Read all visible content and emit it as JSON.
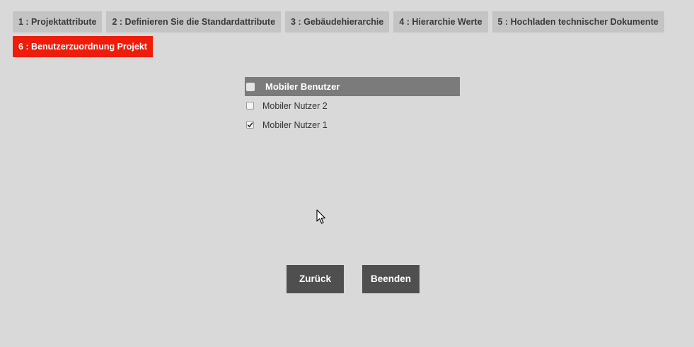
{
  "tabs": [
    {
      "label": "1 : Projektattribute"
    },
    {
      "label": "2 : Definieren Sie die Standardattribute"
    },
    {
      "label": "3 : Gebäudehierarchie"
    },
    {
      "label": "4 : Hierarchie Werte"
    },
    {
      "label": "5 : Hochladen technischer Dokumente"
    },
    {
      "label": "6 : Benutzerzuordnung Projekt"
    }
  ],
  "active_tab": 5,
  "user_table": {
    "header": "Mobiler Benutzer",
    "rows": [
      {
        "label": "Mobiler Nutzer 2",
        "checked": false
      },
      {
        "label": "Mobiler Nutzer 1",
        "checked": true
      }
    ]
  },
  "buttons": {
    "back": "Zurück",
    "finish": "Beenden"
  },
  "colors": {
    "active_tab": "#ee1c0a",
    "tab": "#c4c4c4",
    "header": "#7b7b7b",
    "button": "#4f4f4f",
    "background": "#d9d9d9"
  },
  "icons": {
    "cursor": "mouse-pointer-icon",
    "check": "checkmark-icon"
  }
}
